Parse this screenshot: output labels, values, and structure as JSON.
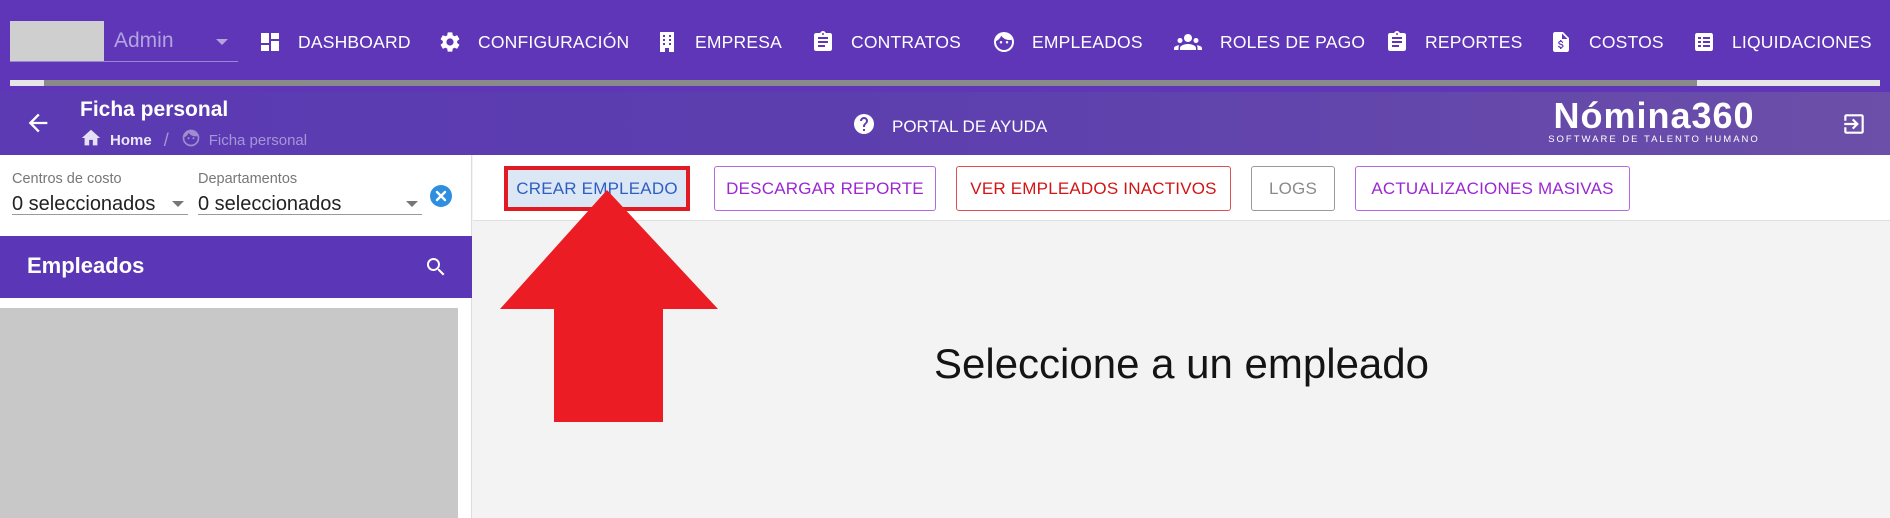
{
  "company": {
    "name": "Admin"
  },
  "nav": {
    "items": [
      {
        "label": "DASHBOARD",
        "icon": "dashboard-icon"
      },
      {
        "label": "CONFIGURACIÓN",
        "icon": "gear-icon"
      },
      {
        "label": "EMPRESA",
        "icon": "building-icon"
      },
      {
        "label": "CONTRATOS",
        "icon": "clipboard-icon"
      },
      {
        "label": "EMPLEADOS",
        "icon": "face-icon"
      },
      {
        "label": "ROLES DE PAGO",
        "icon": "people-icon"
      },
      {
        "label": "REPORTES",
        "icon": "clipboard-list-icon"
      },
      {
        "label": "COSTOS",
        "icon": "dollar-document-icon"
      },
      {
        "label": "LIQUIDACIONES",
        "icon": "list-icon"
      }
    ]
  },
  "header": {
    "title": "Ficha personal",
    "breadcrumb": {
      "home": "Home",
      "current": "Ficha personal"
    },
    "help_label": "PORTAL DE AYUDA",
    "brand": {
      "wordmark": "Nómina360",
      "tagline": "SOFTWARE DE TALENTO HUMANO"
    }
  },
  "filters": {
    "cost_centers": {
      "label": "Centros de costo",
      "value": "0 seleccionados"
    },
    "departments": {
      "label": "Departamentos",
      "value": "0 seleccionados"
    }
  },
  "employees_panel": {
    "title": "Empleados"
  },
  "toolbar": {
    "create_label": "CREAR EMPLEADO",
    "report_label": "DESCARGAR REPORTE",
    "inactive_label": "VER EMPLEADOS INACTIVOS",
    "logs_label": "LOGS",
    "mass_label": "ACTUALIZACIONES MASIVAS"
  },
  "main": {
    "empty_message": "Seleccione a un empleado"
  },
  "colors": {
    "nav_bg": "#5f36b8",
    "panel_header": "#5b36b7",
    "annotation_red": "#e11a24"
  }
}
